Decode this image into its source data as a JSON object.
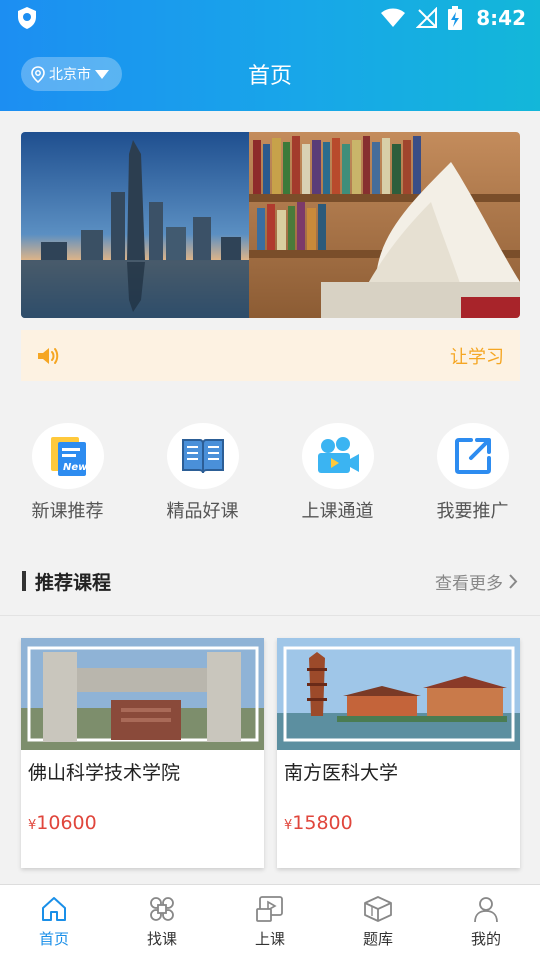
{
  "status_bar": {
    "time": "8:42"
  },
  "header": {
    "location": "北京市",
    "title": "首页"
  },
  "notice": {
    "text": "让学习"
  },
  "quick_links": [
    {
      "label": "新课推荐",
      "icon": "new-course-icon"
    },
    {
      "label": "精品好课",
      "icon": "open-book-icon"
    },
    {
      "label": "上课通道",
      "icon": "video-camera-icon"
    },
    {
      "label": "我要推广",
      "icon": "share-external-icon"
    }
  ],
  "section": {
    "title": "推荐课程",
    "more": "查看更多"
  },
  "courses": [
    {
      "name": "佛山科学技术学院",
      "currency": "¥",
      "price": "10600"
    },
    {
      "name": "南方医科大学",
      "currency": "¥",
      "price": "15800"
    }
  ],
  "tabs": [
    {
      "label": "首页",
      "icon": "home-icon",
      "active": true
    },
    {
      "label": "找课",
      "icon": "find-course-icon",
      "active": false
    },
    {
      "label": "上课",
      "icon": "play-screen-icon",
      "active": false
    },
    {
      "label": "题库",
      "icon": "question-bank-icon",
      "active": false
    },
    {
      "label": "我的",
      "icon": "profile-icon",
      "active": false
    }
  ],
  "colors": {
    "accent": "#1a8fe8",
    "price": "#e0463c",
    "notice_text": "#f5a623",
    "notice_bg": "#fdf2e2"
  }
}
